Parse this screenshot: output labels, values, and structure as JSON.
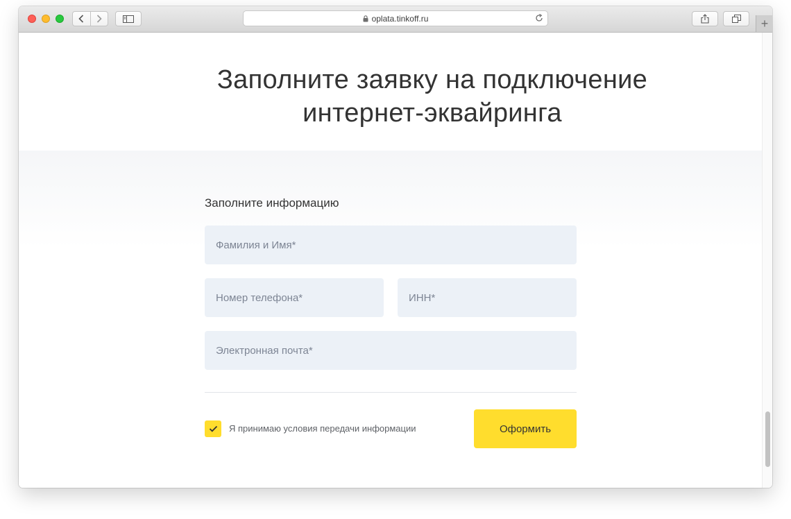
{
  "browser": {
    "url": "oplata.tinkoff.ru",
    "new_tab_label": "+"
  },
  "page": {
    "title_line1": "Заполните заявку на подключение",
    "title_line2": "интернет-эквайринга",
    "form": {
      "heading": "Заполните информацию",
      "full_name_placeholder": "Фамилия и Имя*",
      "phone_placeholder": "Номер телефона*",
      "inn_placeholder": "ИНН*",
      "email_placeholder": "Электронная почта*",
      "consent_checked": true,
      "consent_label": "Я принимаю условия передачи информации",
      "submit_label": "Оформить"
    }
  },
  "colors": {
    "accent": "#ffdd2d",
    "field_background": "#ecf1f7",
    "text": "#333333"
  },
  "icons": {
    "back": "chevron-left-icon",
    "forward": "chevron-right-icon",
    "sidebar": "sidebar-icon",
    "lock": "lock-icon",
    "reload": "reload-icon",
    "share": "share-icon",
    "tabs": "tabs-icon",
    "checkmark": "checkmark-icon"
  }
}
